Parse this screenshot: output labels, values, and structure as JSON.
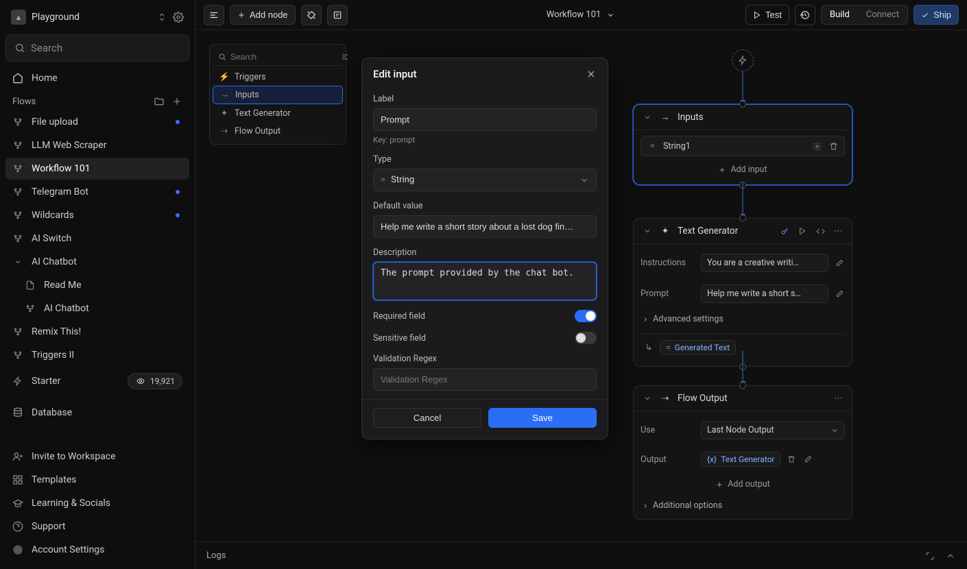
{
  "sidebar": {
    "workspace": "Playground",
    "search_placeholder": "Search",
    "home": "Home",
    "flows_label": "Flows",
    "flows": [
      {
        "name": "File upload",
        "dot": true
      },
      {
        "name": "LLM Web Scraper"
      },
      {
        "name": "Workflow 101",
        "active": true
      },
      {
        "name": "Telegram Bot",
        "dot": true
      },
      {
        "name": "Wildcards",
        "dot": true
      },
      {
        "name": "AI Switch"
      },
      {
        "name": "AI Chatbot",
        "expandable": true
      }
    ],
    "chatbot_children": [
      {
        "name": "Read Me",
        "icon": "file"
      },
      {
        "name": "AI Chatbot",
        "icon": "flow"
      }
    ],
    "more_flows": [
      {
        "name": "Remix This!"
      },
      {
        "name": "Triggers II"
      }
    ],
    "starter": {
      "name": "Starter",
      "count": "19,921"
    },
    "database": "Database",
    "bottom": [
      "Invite to Workspace",
      "Templates",
      "Learning & Socials",
      "Support",
      "Account Settings"
    ]
  },
  "topbar": {
    "add_node": "Add node",
    "title": "Workflow 101",
    "test": "Test",
    "build": "Build",
    "connect": "Connect",
    "ship": "Ship"
  },
  "outline": {
    "search_placeholder": "Search",
    "items": [
      {
        "label": "Triggers",
        "icon": "bolt"
      },
      {
        "label": "Inputs",
        "icon": "input",
        "selected": true
      },
      {
        "label": "Text Generator",
        "icon": "sparkle"
      },
      {
        "label": "Flow Output",
        "icon": "output"
      }
    ]
  },
  "nodes": {
    "inputs": {
      "title": "Inputs",
      "row_label": "String1",
      "add": "Add input"
    },
    "textgen": {
      "title": "Text Generator",
      "instructions_label": "Instructions",
      "instructions_value": "You are a creative writi…",
      "prompt_label": "Prompt",
      "prompt_value": "Help me write a short s…",
      "advanced": "Advanced settings",
      "output": "Generated Text"
    },
    "flowoutput": {
      "title": "Flow Output",
      "use_label": "Use",
      "use_value": "Last Node Output",
      "output_label": "Output",
      "output_chip": "Text Generator",
      "add": "Add output",
      "additional": "Additional options"
    }
  },
  "modal": {
    "title": "Edit input",
    "label_label": "Label",
    "label_value": "Prompt",
    "key_hint": "Key: prompt",
    "type_label": "Type",
    "type_value": "String",
    "default_label": "Default value",
    "default_value": "Help me write a short story about a lost dog fin…",
    "description_label": "Description",
    "description_value": "The prompt provided by the chat bot.",
    "required_label": "Required field",
    "sensitive_label": "Sensitive field",
    "regex_label": "Validation Regex",
    "regex_placeholder": "Validation Regex",
    "cancel": "Cancel",
    "save": "Save"
  },
  "logs": {
    "title": "Logs"
  }
}
